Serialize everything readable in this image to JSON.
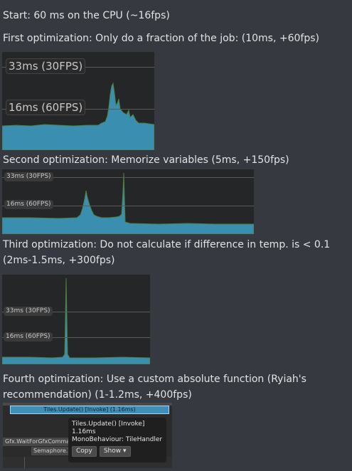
{
  "lines": {
    "start": "Start: 60 ms on the CPU (~16fps)",
    "first": "First optimization: Only do a fraction of the job: (10ms, +60fps)",
    "second": "Second optimization: Memorize variables (5ms, +150fps)",
    "third": "Third optimization: Do not calculate if difference in temp. is < 0.1 (2ms-1.5ms, +300fps)",
    "fourth": "Fourth optimization: Use a custom absolute function (Ryiah's recommendation) (1-1.2ms, +400fps)"
  },
  "profiler_labels": {
    "p33": "33ms (30FPS)",
    "p16": "16ms (60FPS)"
  },
  "timeline": {
    "update_bar": "Tiles.Update() [Invoke] (1.16ms)",
    "row1": "Gfx.WaitForGfxComma",
    "row2": "Semaphore.W",
    "tooltip_title": "Tiles.Update() [Invoke]",
    "tooltip_time": "1.16ms",
    "tooltip_detail": "MonoBehaviour: TileHandler",
    "copy_label": "Copy",
    "show_label": "Show ▾"
  },
  "colors": {
    "background": "#36393f",
    "profiler_bg": "#252628",
    "graph_blue": "#3a8fb0",
    "graph_green": "#4a7a3a"
  }
}
